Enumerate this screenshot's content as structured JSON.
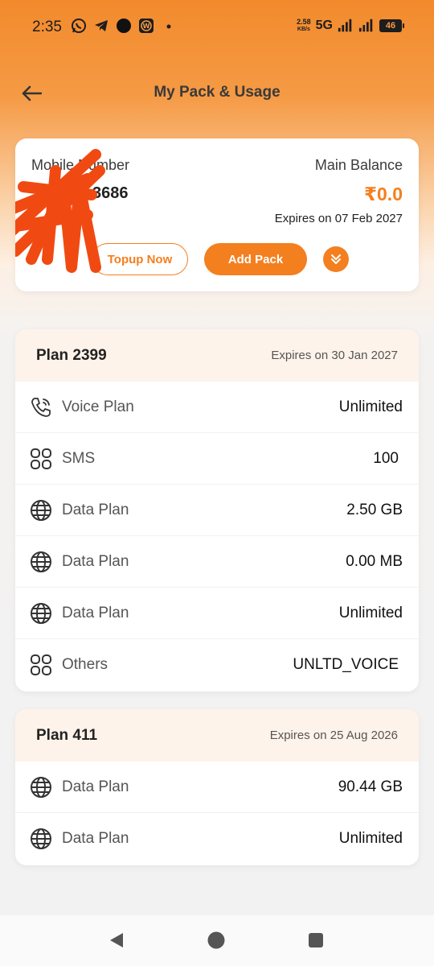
{
  "status_bar": {
    "time": "2:35",
    "net_speed_value": "2.58",
    "net_speed_unit": "KB/s",
    "network_type": "5G",
    "battery": "46"
  },
  "header": {
    "title": "My Pack & Usage",
    "back_icon": "arrow-left-icon"
  },
  "account": {
    "number_label": "Mobile Number",
    "number_value": "3686",
    "balance_label": "Main Balance",
    "balance_value": "₹0.0",
    "expiry": "Expires on 07 Feb 2027",
    "topup_label": "Topup Now",
    "add_pack_label": "Add Pack",
    "accent_color": "#f47f1f"
  },
  "plans": [
    {
      "name": "Plan 2399",
      "expiry": "Expires on 30 Jan 2027",
      "rows": [
        {
          "icon": "phone-icon",
          "label": "Voice Plan",
          "value": "Unlimited"
        },
        {
          "icon": "grid-icon",
          "label": "SMS",
          "value": "100"
        },
        {
          "icon": "globe-icon",
          "label": "Data Plan",
          "value": "2.50 GB"
        },
        {
          "icon": "globe-icon",
          "label": "Data Plan",
          "value": "0.00 MB"
        },
        {
          "icon": "globe-icon",
          "label": "Data Plan",
          "value": "Unlimited"
        },
        {
          "icon": "grid-icon",
          "label": "Others",
          "value": "UNLTD_VOICE"
        }
      ]
    },
    {
      "name": "Plan 411",
      "expiry": "Expires on 25 Aug 2026",
      "rows": [
        {
          "icon": "globe-icon",
          "label": "Data Plan",
          "value": "90.44 GB"
        },
        {
          "icon": "globe-icon",
          "label": "Data Plan",
          "value": "Unlimited"
        }
      ]
    }
  ]
}
